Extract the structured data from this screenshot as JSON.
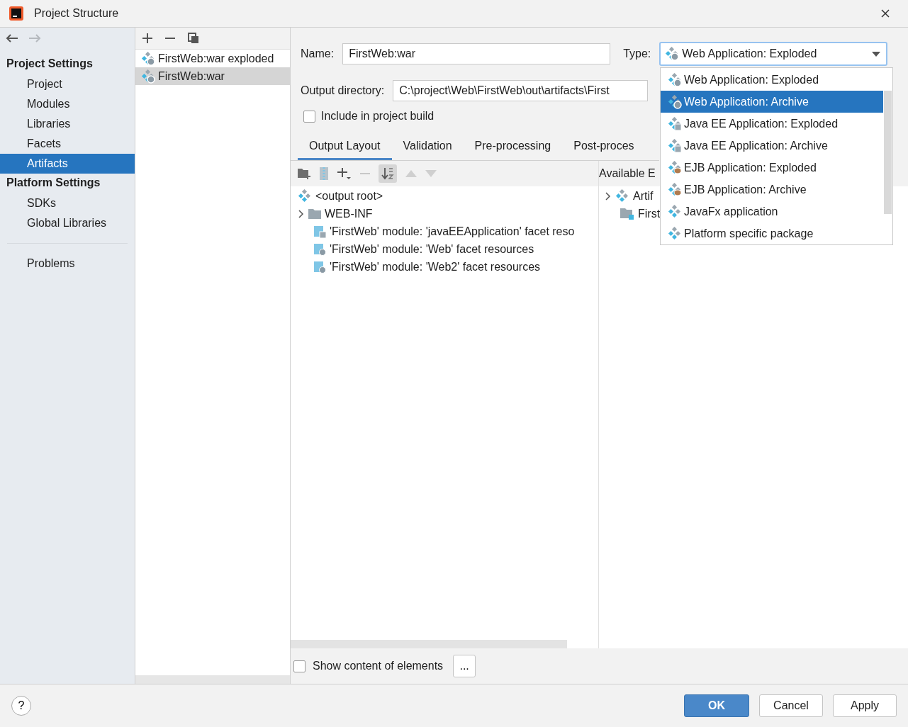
{
  "window": {
    "title": "Project Structure"
  },
  "nav": [
    {
      "kind": "back",
      "disabled": false
    },
    {
      "kind": "forward",
      "disabled": true
    }
  ],
  "sidebar": {
    "sections": [
      {
        "title": "Project Settings",
        "items": [
          {
            "label": "Project",
            "selected": false
          },
          {
            "label": "Modules",
            "selected": false
          },
          {
            "label": "Libraries",
            "selected": false
          },
          {
            "label": "Facets",
            "selected": false
          },
          {
            "label": "Artifacts",
            "selected": true
          }
        ]
      },
      {
        "title": "Platform Settings",
        "items": [
          {
            "label": "SDKs",
            "selected": false
          },
          {
            "label": "Global Libraries",
            "selected": false
          }
        ]
      }
    ],
    "problems": {
      "label": "Problems",
      "selected": false
    }
  },
  "artifacts": [
    {
      "label": "FirstWeb:war exploded",
      "selected": false
    },
    {
      "label": "FirstWeb:war",
      "selected": true
    }
  ],
  "editor": {
    "name_label": "Name:",
    "name_value": "FirstWeb:war",
    "type_label": "Type:",
    "type_value": "Web Application: Exploded",
    "output_label": "Output directory:",
    "output_value": "C:\\project\\Web\\FirstWeb\\out\\artifacts\\First",
    "include": {
      "label": "Include in project build",
      "checked": false
    },
    "tabs": [
      {
        "label": "Output Layout",
        "selected": true
      },
      {
        "label": "Validation",
        "selected": false
      },
      {
        "label": "Pre-processing",
        "selected": false
      },
      {
        "label": "Post-proces",
        "selected": false
      }
    ],
    "available_label": "Available E",
    "layout_tree": [
      {
        "label": "<output root>",
        "kind": "root"
      },
      {
        "label": "WEB-INF",
        "kind": "folder",
        "expanded": false
      },
      {
        "label": "'FirstWeb' module: 'javaEEApplication' facet reso",
        "kind": "ee-facet"
      },
      {
        "label": "'FirstWeb' module: 'Web' facet resources",
        "kind": "web-facet"
      },
      {
        "label": "'FirstWeb' module: 'Web2' facet resources",
        "kind": "web-facet"
      }
    ],
    "available_tree": [
      {
        "label": "Artif",
        "kind": "root",
        "expanded": false
      },
      {
        "label": "First",
        "kind": "module"
      }
    ],
    "show_content": {
      "label": "Show content of elements",
      "checked": false
    },
    "more_button": "..."
  },
  "type_dropdown": [
    {
      "label": "Web Application: Exploded",
      "kind": "web",
      "selected": false
    },
    {
      "label": "Web Application: Archive",
      "kind": "web",
      "selected": true
    },
    {
      "label": "Java EE Application: Exploded",
      "kind": "ee",
      "selected": false
    },
    {
      "label": "Java EE Application: Archive",
      "kind": "ee",
      "selected": false
    },
    {
      "label": "EJB Application: Exploded",
      "kind": "ejb",
      "selected": false
    },
    {
      "label": "EJB Application: Archive",
      "kind": "ejb",
      "selected": false
    },
    {
      "label": "JavaFx application",
      "kind": "fx",
      "selected": false
    },
    {
      "label": "Platform specific package",
      "kind": "fx",
      "selected": false
    }
  ],
  "help": "?",
  "buttons": [
    {
      "label": "OK",
      "kind": "primary"
    },
    {
      "label": "Cancel",
      "kind": "normal"
    },
    {
      "label": "Apply",
      "kind": "normal"
    }
  ]
}
